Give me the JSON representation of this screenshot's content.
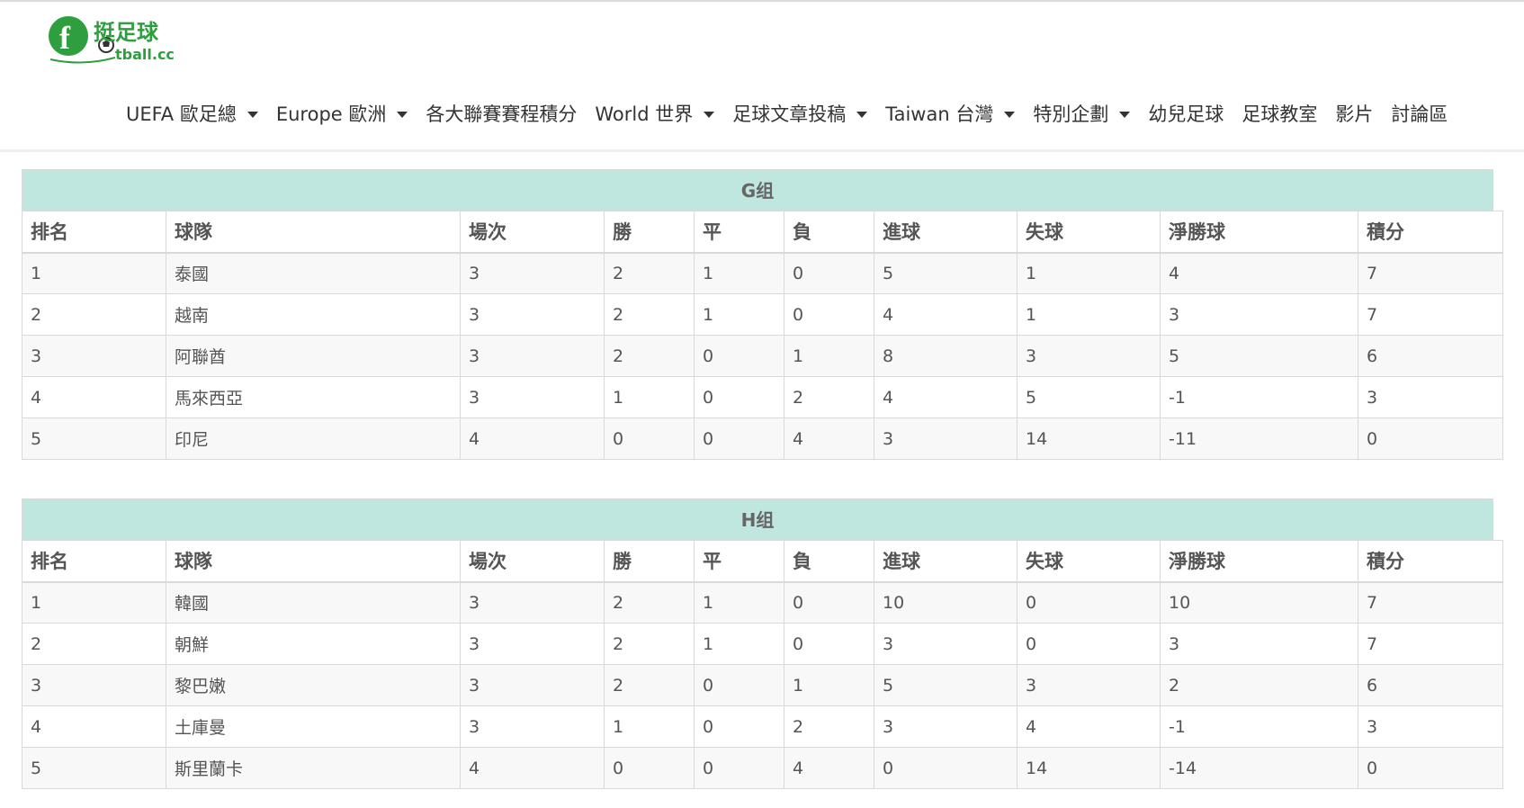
{
  "logo": {
    "main": "挺足球",
    "sub": "tball.cc",
    "letter": "f",
    "alt_text": "Football.cc"
  },
  "nav": [
    {
      "label": "UEFA 歐足總",
      "dropdown": true
    },
    {
      "label": "Europe 歐洲",
      "dropdown": true
    },
    {
      "label": "各大聯賽賽程積分",
      "dropdown": false
    },
    {
      "label": "World 世界",
      "dropdown": true
    },
    {
      "label": "足球文章投稿",
      "dropdown": true
    },
    {
      "label": "Taiwan 台灣",
      "dropdown": true
    },
    {
      "label": "特別企劃",
      "dropdown": true
    },
    {
      "label": "幼兒足球",
      "dropdown": false
    },
    {
      "label": "足球教室",
      "dropdown": false
    },
    {
      "label": "影片",
      "dropdown": false
    },
    {
      "label": "討論區",
      "dropdown": false
    }
  ],
  "columns": [
    "排名",
    "球隊",
    "場次",
    "勝",
    "平",
    "負",
    "進球",
    "失球",
    "淨勝球",
    "積分"
  ],
  "groups": [
    {
      "title": "G组",
      "rows": [
        [
          "1",
          "泰國",
          "3",
          "2",
          "1",
          "0",
          "5",
          "1",
          "4",
          "7"
        ],
        [
          "2",
          "越南",
          "3",
          "2",
          "1",
          "0",
          "4",
          "1",
          "3",
          "7"
        ],
        [
          "3",
          "阿聯酋",
          "3",
          "2",
          "0",
          "1",
          "8",
          "3",
          "5",
          "6"
        ],
        [
          "4",
          "馬來西亞",
          "3",
          "1",
          "0",
          "2",
          "4",
          "5",
          "-1",
          "3"
        ],
        [
          "5",
          "印尼",
          "4",
          "0",
          "0",
          "4",
          "3",
          "14",
          "-11",
          "0"
        ]
      ]
    },
    {
      "title": "H组",
      "rows": [
        [
          "1",
          "韓國",
          "3",
          "2",
          "1",
          "0",
          "10",
          "0",
          "10",
          "7"
        ],
        [
          "2",
          "朝鮮",
          "3",
          "2",
          "1",
          "0",
          "3",
          "0",
          "3",
          "7"
        ],
        [
          "3",
          "黎巴嫩",
          "3",
          "2",
          "0",
          "1",
          "5",
          "3",
          "2",
          "6"
        ],
        [
          "4",
          "土庫曼",
          "3",
          "1",
          "0",
          "2",
          "3",
          "4",
          "-1",
          "3"
        ],
        [
          "5",
          "斯里蘭卡",
          "4",
          "0",
          "0",
          "4",
          "0",
          "14",
          "-14",
          "0"
        ]
      ]
    }
  ],
  "colors": {
    "brand_green": "#2e9e3e",
    "group_header_bg": "#bfe6df"
  }
}
